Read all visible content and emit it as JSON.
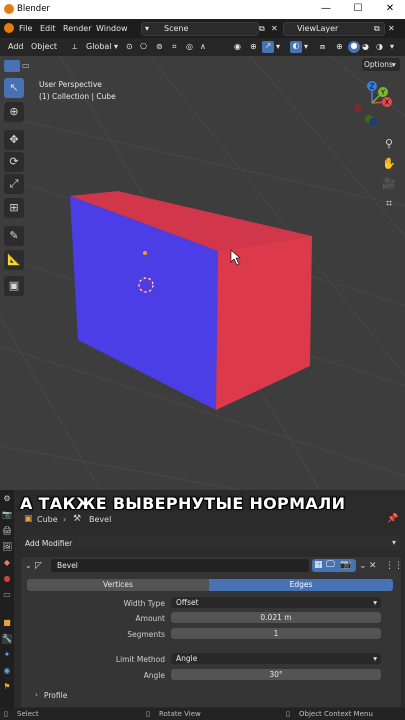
{
  "window": {
    "title": "Blender",
    "minimize": "—",
    "maximize": "☐",
    "close": "✕"
  },
  "menubar": {
    "items": [
      "File",
      "Edit",
      "Render",
      "Window"
    ],
    "scene": "Scene",
    "view_layer": "ViewLayer"
  },
  "header": {
    "add": "Add",
    "object": "Object",
    "orientation": "Global",
    "options": "Options"
  },
  "viewport": {
    "perspective": "User Perspective",
    "collection": "(1) Collection | Cube",
    "gizmo": {
      "x": "X",
      "y": "Y",
      "z": "Z"
    },
    "colors": {
      "red_face": "#d93a4a",
      "blue_face": "#4a3fe0"
    }
  },
  "caption": "А ТАКЖЕ ВЫВЕРНУТЫЕ НОРМАЛИ",
  "properties": {
    "breadcrumb_object": "Cube",
    "breadcrumb_modifier": "Bevel",
    "add_modifier": "Add Modifier",
    "modifier_name": "Bevel",
    "tabs": {
      "vertices": "Vertices",
      "edges": "Edges"
    },
    "rows": {
      "width_type_label": "Width Type",
      "width_type_value": "Offset",
      "amount_label": "Amount",
      "amount_value": "0.021 m",
      "segments_label": "Segments",
      "segments_value": "1",
      "limit_method_label": "Limit Method",
      "limit_method_value": "Angle",
      "angle_label": "Angle",
      "angle_value": "30°"
    },
    "profile": "Profile"
  },
  "statusbar": {
    "select": "Select",
    "rotate": "Rotate View",
    "context": "Object Context Menu"
  }
}
